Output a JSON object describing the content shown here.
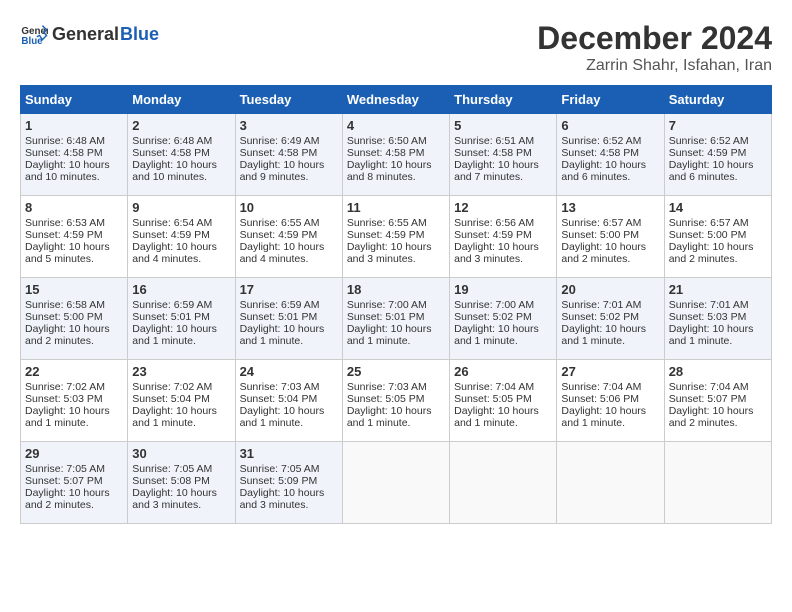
{
  "header": {
    "logo_general": "General",
    "logo_blue": "Blue",
    "month_title": "December 2024",
    "location": "Zarrin Shahr, Isfahan, Iran"
  },
  "days_of_week": [
    "Sunday",
    "Monday",
    "Tuesday",
    "Wednesday",
    "Thursday",
    "Friday",
    "Saturday"
  ],
  "weeks": [
    [
      {
        "day": "1",
        "sunrise": "Sunrise: 6:48 AM",
        "sunset": "Sunset: 4:58 PM",
        "daylight": "Daylight: 10 hours and 10 minutes."
      },
      {
        "day": "2",
        "sunrise": "Sunrise: 6:48 AM",
        "sunset": "Sunset: 4:58 PM",
        "daylight": "Daylight: 10 hours and 10 minutes."
      },
      {
        "day": "3",
        "sunrise": "Sunrise: 6:49 AM",
        "sunset": "Sunset: 4:58 PM",
        "daylight": "Daylight: 10 hours and 9 minutes."
      },
      {
        "day": "4",
        "sunrise": "Sunrise: 6:50 AM",
        "sunset": "Sunset: 4:58 PM",
        "daylight": "Daylight: 10 hours and 8 minutes."
      },
      {
        "day": "5",
        "sunrise": "Sunrise: 6:51 AM",
        "sunset": "Sunset: 4:58 PM",
        "daylight": "Daylight: 10 hours and 7 minutes."
      },
      {
        "day": "6",
        "sunrise": "Sunrise: 6:52 AM",
        "sunset": "Sunset: 4:58 PM",
        "daylight": "Daylight: 10 hours and 6 minutes."
      },
      {
        "day": "7",
        "sunrise": "Sunrise: 6:52 AM",
        "sunset": "Sunset: 4:59 PM",
        "daylight": "Daylight: 10 hours and 6 minutes."
      }
    ],
    [
      {
        "day": "8",
        "sunrise": "Sunrise: 6:53 AM",
        "sunset": "Sunset: 4:59 PM",
        "daylight": "Daylight: 10 hours and 5 minutes."
      },
      {
        "day": "9",
        "sunrise": "Sunrise: 6:54 AM",
        "sunset": "Sunset: 4:59 PM",
        "daylight": "Daylight: 10 hours and 4 minutes."
      },
      {
        "day": "10",
        "sunrise": "Sunrise: 6:55 AM",
        "sunset": "Sunset: 4:59 PM",
        "daylight": "Daylight: 10 hours and 4 minutes."
      },
      {
        "day": "11",
        "sunrise": "Sunrise: 6:55 AM",
        "sunset": "Sunset: 4:59 PM",
        "daylight": "Daylight: 10 hours and 3 minutes."
      },
      {
        "day": "12",
        "sunrise": "Sunrise: 6:56 AM",
        "sunset": "Sunset: 4:59 PM",
        "daylight": "Daylight: 10 hours and 3 minutes."
      },
      {
        "day": "13",
        "sunrise": "Sunrise: 6:57 AM",
        "sunset": "Sunset: 5:00 PM",
        "daylight": "Daylight: 10 hours and 2 minutes."
      },
      {
        "day": "14",
        "sunrise": "Sunrise: 6:57 AM",
        "sunset": "Sunset: 5:00 PM",
        "daylight": "Daylight: 10 hours and 2 minutes."
      }
    ],
    [
      {
        "day": "15",
        "sunrise": "Sunrise: 6:58 AM",
        "sunset": "Sunset: 5:00 PM",
        "daylight": "Daylight: 10 hours and 2 minutes."
      },
      {
        "day": "16",
        "sunrise": "Sunrise: 6:59 AM",
        "sunset": "Sunset: 5:01 PM",
        "daylight": "Daylight: 10 hours and 1 minute."
      },
      {
        "day": "17",
        "sunrise": "Sunrise: 6:59 AM",
        "sunset": "Sunset: 5:01 PM",
        "daylight": "Daylight: 10 hours and 1 minute."
      },
      {
        "day": "18",
        "sunrise": "Sunrise: 7:00 AM",
        "sunset": "Sunset: 5:01 PM",
        "daylight": "Daylight: 10 hours and 1 minute."
      },
      {
        "day": "19",
        "sunrise": "Sunrise: 7:00 AM",
        "sunset": "Sunset: 5:02 PM",
        "daylight": "Daylight: 10 hours and 1 minute."
      },
      {
        "day": "20",
        "sunrise": "Sunrise: 7:01 AM",
        "sunset": "Sunset: 5:02 PM",
        "daylight": "Daylight: 10 hours and 1 minute."
      },
      {
        "day": "21",
        "sunrise": "Sunrise: 7:01 AM",
        "sunset": "Sunset: 5:03 PM",
        "daylight": "Daylight: 10 hours and 1 minute."
      }
    ],
    [
      {
        "day": "22",
        "sunrise": "Sunrise: 7:02 AM",
        "sunset": "Sunset: 5:03 PM",
        "daylight": "Daylight: 10 hours and 1 minute."
      },
      {
        "day": "23",
        "sunrise": "Sunrise: 7:02 AM",
        "sunset": "Sunset: 5:04 PM",
        "daylight": "Daylight: 10 hours and 1 minute."
      },
      {
        "day": "24",
        "sunrise": "Sunrise: 7:03 AM",
        "sunset": "Sunset: 5:04 PM",
        "daylight": "Daylight: 10 hours and 1 minute."
      },
      {
        "day": "25",
        "sunrise": "Sunrise: 7:03 AM",
        "sunset": "Sunset: 5:05 PM",
        "daylight": "Daylight: 10 hours and 1 minute."
      },
      {
        "day": "26",
        "sunrise": "Sunrise: 7:04 AM",
        "sunset": "Sunset: 5:05 PM",
        "daylight": "Daylight: 10 hours and 1 minute."
      },
      {
        "day": "27",
        "sunrise": "Sunrise: 7:04 AM",
        "sunset": "Sunset: 5:06 PM",
        "daylight": "Daylight: 10 hours and 1 minute."
      },
      {
        "day": "28",
        "sunrise": "Sunrise: 7:04 AM",
        "sunset": "Sunset: 5:07 PM",
        "daylight": "Daylight: 10 hours and 2 minutes."
      }
    ],
    [
      {
        "day": "29",
        "sunrise": "Sunrise: 7:05 AM",
        "sunset": "Sunset: 5:07 PM",
        "daylight": "Daylight: 10 hours and 2 minutes."
      },
      {
        "day": "30",
        "sunrise": "Sunrise: 7:05 AM",
        "sunset": "Sunset: 5:08 PM",
        "daylight": "Daylight: 10 hours and 3 minutes."
      },
      {
        "day": "31",
        "sunrise": "Sunrise: 7:05 AM",
        "sunset": "Sunset: 5:09 PM",
        "daylight": "Daylight: 10 hours and 3 minutes."
      },
      null,
      null,
      null,
      null
    ]
  ]
}
